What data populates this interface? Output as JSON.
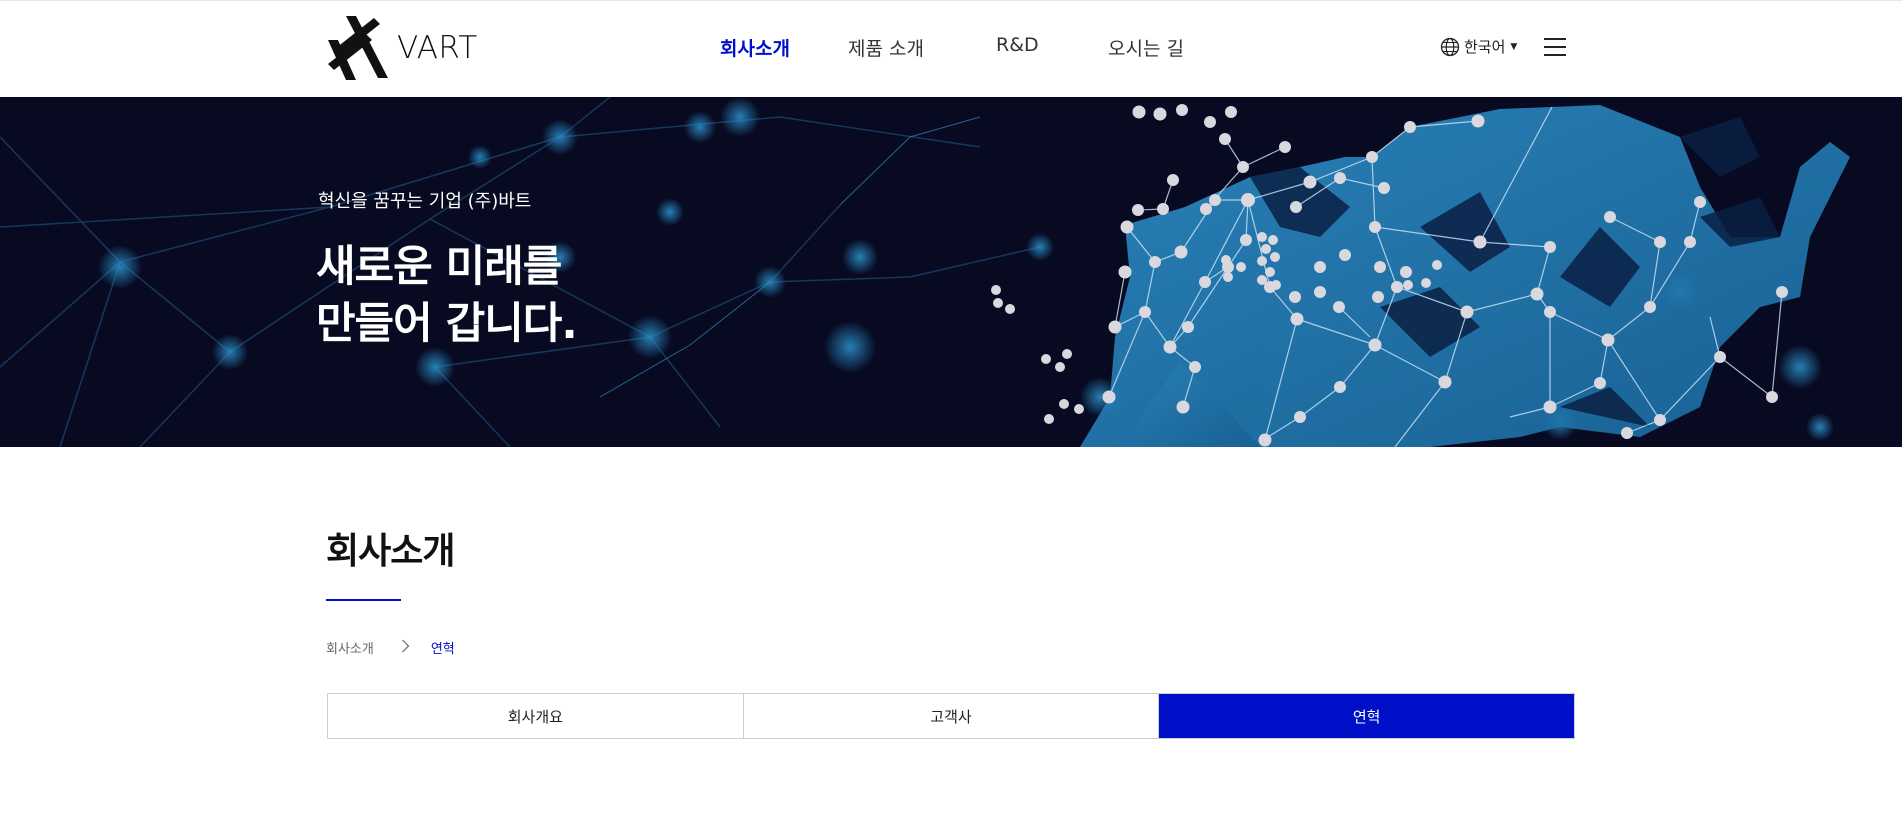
{
  "header": {
    "logo_text": "VART",
    "nav": [
      {
        "label": "회사소개",
        "active": true
      },
      {
        "label": "제품 소개",
        "active": false
      },
      {
        "label": "R&D",
        "active": false
      },
      {
        "label": "오시는 길",
        "active": false
      }
    ],
    "language": {
      "label": "한국어",
      "icon": "globe-icon",
      "caret_icon": "caret-down-icon"
    },
    "menu_icon": "hamburger-menu-icon"
  },
  "hero": {
    "subtitle": "혁신을 꿈꾸는 기업 (주)바트",
    "title_line1": "새로운 미래를",
    "title_line2": "만들어 갑니다."
  },
  "content": {
    "page_title": "회사소개",
    "breadcrumb": {
      "home": "회사소개",
      "current": "연혁"
    },
    "tabs": [
      {
        "label": "회사개요",
        "active": false
      },
      {
        "label": "고객사",
        "active": false
      },
      {
        "label": "연혁",
        "active": true
      }
    ]
  },
  "colors": {
    "accent": "#0010c8",
    "hero_bg": "#080a22",
    "network_blue": "#2a8cc4"
  }
}
